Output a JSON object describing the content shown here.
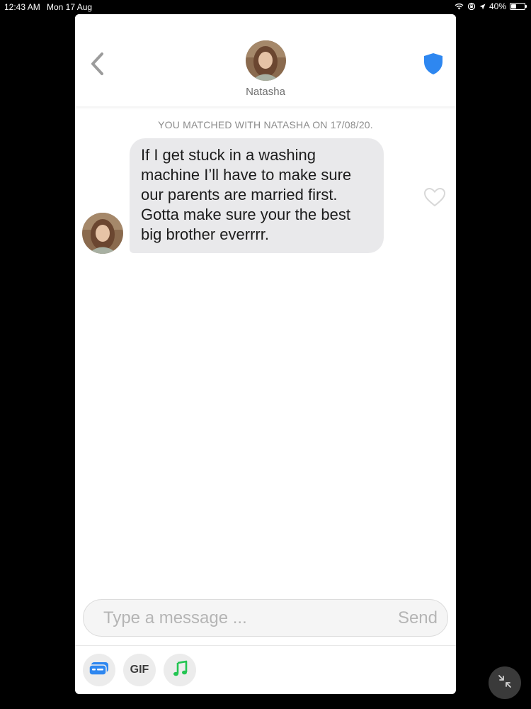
{
  "status_bar": {
    "time": "12:43 AM",
    "date": "Mon 17 Aug",
    "battery_text": "40%",
    "battery_level": 0.4
  },
  "header": {
    "name": "Natasha",
    "back_icon": "chevron-left-icon",
    "shield_icon": "shield-icon",
    "shield_color": "#2e87f0"
  },
  "chat": {
    "match_notice": "YOU MATCHED WITH NATASHA ON 17/08/20.",
    "messages": [
      {
        "text": "If I get stuck in a washing machine I’ll have to make sure our parents are married first. Gotta make sure your the best big brother everrrr."
      }
    ]
  },
  "composer": {
    "placeholder": "Type a message ...",
    "send_label": "Send"
  },
  "tools": {
    "gif_label": "GIF",
    "card_color": "#2e87f0",
    "music_color": "#23c552"
  }
}
